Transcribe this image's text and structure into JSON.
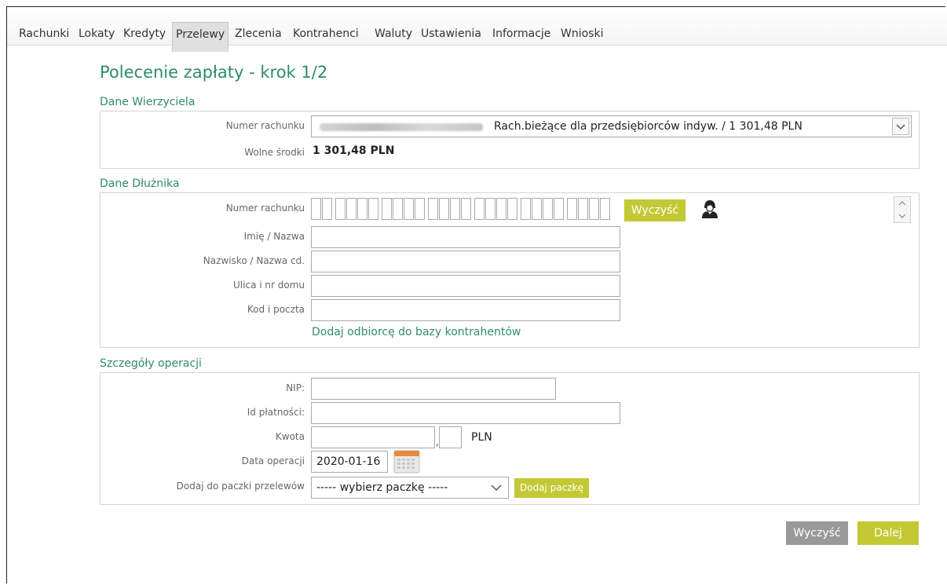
{
  "nav": {
    "tabs": [
      {
        "label": "Rachunki"
      },
      {
        "label": "Lokaty"
      },
      {
        "label": "Kredyty"
      },
      {
        "label": "Przelewy",
        "active": true
      },
      {
        "label": "Zlecenia"
      },
      {
        "label": "Kontrahenci"
      },
      {
        "label": "Waluty"
      },
      {
        "label": "Ustawienia"
      },
      {
        "label": "Informacje"
      },
      {
        "label": "Wnioski"
      }
    ]
  },
  "page": {
    "title": "Polecenie zapłaty - krok 1/2"
  },
  "creditor": {
    "heading": "Dane Wierzyciela",
    "account_label": "Numer rachunku",
    "account_value": "Rach.bieżące dla przedsiębiorców indyw. / 1 301,48 PLN",
    "funds_label": "Wolne środki",
    "funds_value": "1 301,48 PLN"
  },
  "debtor": {
    "heading": "Dane Dłużnika",
    "account_label": "Numer rachunku",
    "clear_label": "Wyczyść",
    "name_label": "Imię / Nazwa",
    "surname_label": "Nazwisko / Nazwa cd.",
    "street_label": "Ulica i nr domu",
    "postal_label": "Kod i poczta",
    "add_link": "Dodaj odbiorcę do bazy kontrahentów"
  },
  "details": {
    "heading": "Szczegóły operacji",
    "nip_label": "NIP:",
    "payment_id_label": "Id płatności:",
    "amount_label": "Kwota",
    "currency": "PLN",
    "date_label": "Data operacji",
    "date_value": "2020-01-16",
    "batch_label": "Dodaj do paczki przelewów",
    "batch_selected": "----- wybierz paczkę -----",
    "add_batch_label": "Dodaj paczkę"
  },
  "footer": {
    "clear_label": "Wyczyść",
    "next_label": "Dalej"
  },
  "colors": {
    "accent": "#2e8b6e",
    "button_lime": "#c3c934",
    "button_grey": "#999999"
  }
}
